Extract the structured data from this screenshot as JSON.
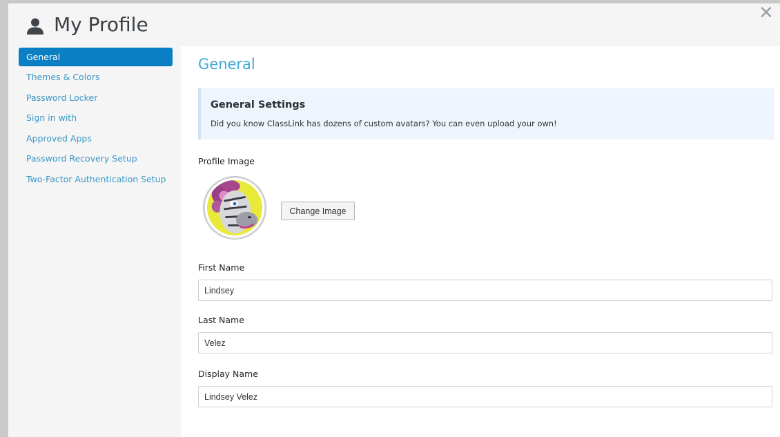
{
  "header": {
    "title": "My Profile"
  },
  "sidebar": {
    "items": [
      {
        "label": "General"
      },
      {
        "label": "Themes & Colors"
      },
      {
        "label": "Password Locker"
      },
      {
        "label": "Sign in with"
      },
      {
        "label": "Approved Apps"
      },
      {
        "label": "Password Recovery Setup"
      },
      {
        "label": "Two-Factor Authentication Setup"
      }
    ]
  },
  "main": {
    "section_title": "General",
    "info": {
      "title": "General Settings",
      "text": "Did you know ClassLink has dozens of custom avatars? You can even upload your own!"
    },
    "profile_image": {
      "label": "Profile Image",
      "button_label": "Change Image"
    },
    "fields": {
      "first_name": {
        "label": "First Name",
        "value": "Lindsey"
      },
      "last_name": {
        "label": "Last Name",
        "value": "Velez"
      },
      "display_name": {
        "label": "Display Name",
        "value": "Lindsey Velez"
      }
    }
  },
  "icons": {
    "title": "user-icon",
    "close": "close-icon",
    "avatar": "zebra-avatar-icon"
  },
  "colors": {
    "accent": "#0a7fc3",
    "link": "#3b97c7",
    "section_title": "#40a8d6",
    "info_bg": "#eef5fc"
  }
}
